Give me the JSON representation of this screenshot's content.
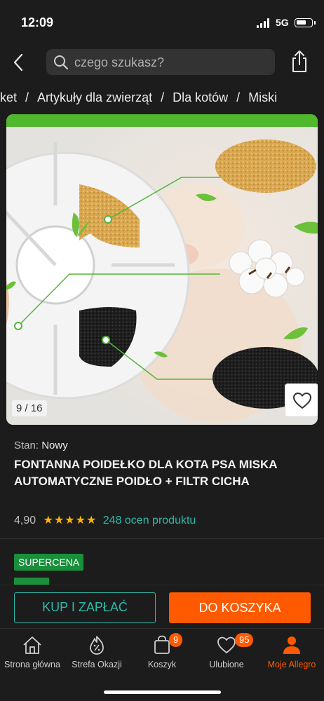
{
  "status_bar": {
    "time": "12:09",
    "network": "5G"
  },
  "header": {
    "search_placeholder": "czego szukasz?"
  },
  "breadcrumb": [
    "rket",
    "Artykuły dla zwierząt",
    "Dla kotów",
    "Miski"
  ],
  "gallery": {
    "counter": "9 / 16"
  },
  "product": {
    "condition_label": "Stan:",
    "condition_value": "Nowy",
    "title": "FONTANNA POIDEŁKO DLA KOTA PSA MISKA AUTOMATYCZNE POIDŁO + FILTR CICHA",
    "rating": "4,90",
    "stars": "★★★★★",
    "rating_count": "248 ocen produktu",
    "badge": "SUPERCENA"
  },
  "actions": {
    "buy_now": "KUP I ZAPŁAĆ",
    "add_to_cart": "DO KOSZYKA"
  },
  "nav": {
    "home": "Strona główna",
    "deals": "Strefa Okazji",
    "cart": "Koszyk",
    "cart_count": "9",
    "favorites": "Ulubione",
    "favorites_count": "95",
    "my_allegro": "Moje Allegro"
  },
  "colors": {
    "accent": "#ff5a00",
    "link": "#2bbba8",
    "badge": "#1a8f3b",
    "star": "#ffb400"
  }
}
